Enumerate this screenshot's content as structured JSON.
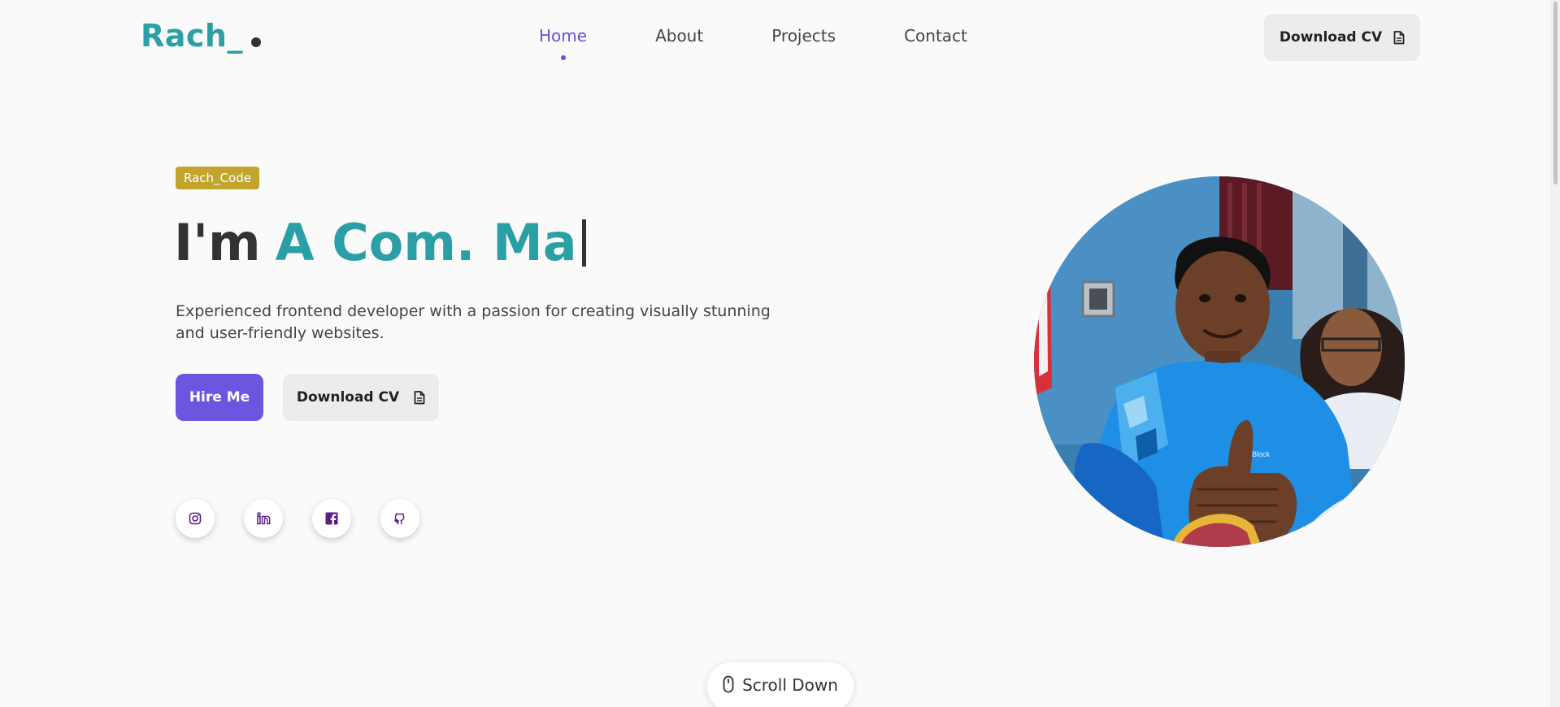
{
  "brand": {
    "logo_text": "Rach_"
  },
  "nav": {
    "items": [
      {
        "label": "Home",
        "active": true
      },
      {
        "label": "About",
        "active": false
      },
      {
        "label": "Projects",
        "active": false
      },
      {
        "label": "Contact",
        "active": false
      }
    ],
    "download_cv_label": "Download CV"
  },
  "hero": {
    "badge": "Rach_Code",
    "headline_prefix": "I'm",
    "headline_typed": "A Com. Ma",
    "description": "Experienced frontend developer with a passion for creating visually stunning and user-friendly websites.",
    "hire_label": "Hire Me",
    "download_cv_label": "Download CV"
  },
  "socials": [
    "instagram-icon",
    "linkedin-icon",
    "facebook-icon",
    "github-icon"
  ],
  "scroll": {
    "label": "Scroll Down"
  },
  "colors": {
    "accent_teal": "#2a9fa5",
    "accent_purple": "#6c56e0",
    "badge_gold": "#c3a52e",
    "background": "#fafafa"
  }
}
